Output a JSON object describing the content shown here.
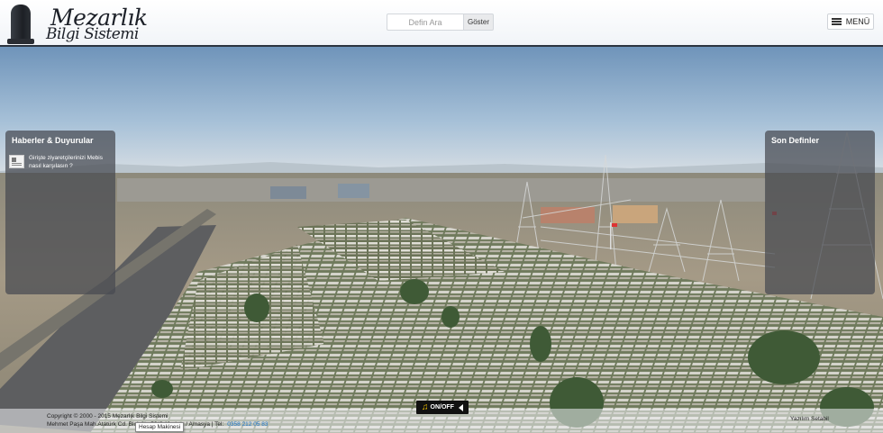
{
  "header": {
    "logo_line1": "Mezarlık",
    "logo_line2": "Bilgi Sistemi",
    "search_placeholder": "Defin Ara",
    "search_button": "Göster",
    "menu_label": "MENÜ"
  },
  "panels": {
    "news": {
      "title": "Haberler & Duyurular",
      "items": [
        {
          "text": "Girişte ziyaretçilerinizi Mebis nasıl karşılasın ?"
        }
      ]
    },
    "recent": {
      "title": "Son Definler"
    }
  },
  "footer": {
    "copyright": "Copyright © 2000 - 2015 Mezarlık Bilgi Sistemi",
    "address": "Mehmet Paşa Mah.Atatürk Cd. Blok No:58/G Merkez / Amasya | Tel:",
    "phone": "0358 212 05 83",
    "credits": "Yazılım Setabil"
  },
  "tooltip": "Hesap Makinesi",
  "music_toggle": "ON/OFF",
  "colors": {
    "header_border": "#2c3440",
    "panel_bg": "#464a50",
    "phone": "#1a74c9"
  },
  "icons": {
    "logo": "tombstone-icon",
    "menu": "hamburger-icon",
    "news": "newspaper-icon",
    "music": "music-note-icon",
    "speaker": "speaker-icon"
  }
}
